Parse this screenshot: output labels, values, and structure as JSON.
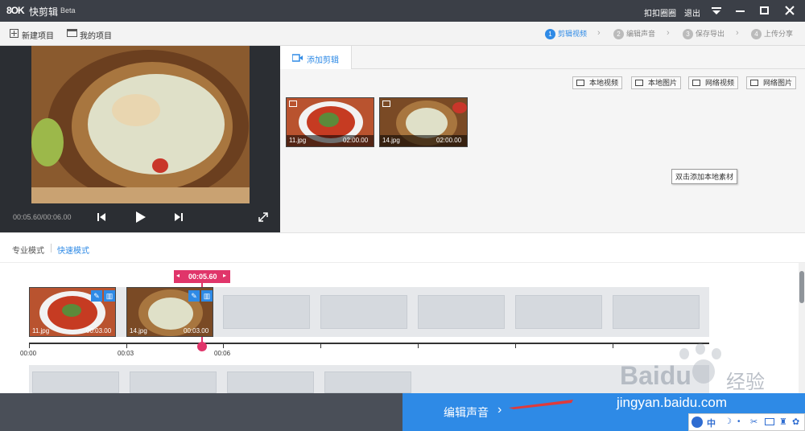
{
  "titlebar": {
    "logo": "8OK",
    "app_name": "快剪辑",
    "beta": "Beta",
    "kouqu": "扣扣圈圈",
    "logout": "退出"
  },
  "toolbar": {
    "new_project": "新建项目",
    "my_projects": "我的项目",
    "steps": [
      {
        "num": "1",
        "label": "剪辑视频",
        "active": true
      },
      {
        "num": "2",
        "label": "编辑声音",
        "active": false
      },
      {
        "num": "3",
        "label": "保存导出",
        "active": false
      },
      {
        "num": "4",
        "label": "上传分享",
        "active": false
      }
    ]
  },
  "preview": {
    "time": "00:05.60/00:06.00"
  },
  "media": {
    "tab": "添加剪辑",
    "buttons": [
      "本地视频",
      "本地图片",
      "网络视频",
      "网络图片"
    ],
    "items": [
      {
        "name": "11.jpg",
        "duration": "02:00.00"
      },
      {
        "name": "14.jpg",
        "duration": "02:00.00"
      }
    ],
    "tooltip": "双击添加本地素材"
  },
  "modes": {
    "pro": "专业模式",
    "fast": "快速模式"
  },
  "timeline": {
    "playhead": "00:05.60",
    "clips": [
      {
        "name": "11.jpg",
        "duration": "00:03.00"
      },
      {
        "name": "14.jpg",
        "duration": "00:03.00"
      }
    ],
    "ruler": [
      "00:00",
      "00:03",
      "00:06"
    ]
  },
  "bottom": {
    "next_button": "编辑声音"
  },
  "watermark": {
    "brand": "Baidu",
    "jingyan": "经验",
    "url": "jingyan.baidu.com"
  },
  "ime": {
    "lang": "中"
  }
}
